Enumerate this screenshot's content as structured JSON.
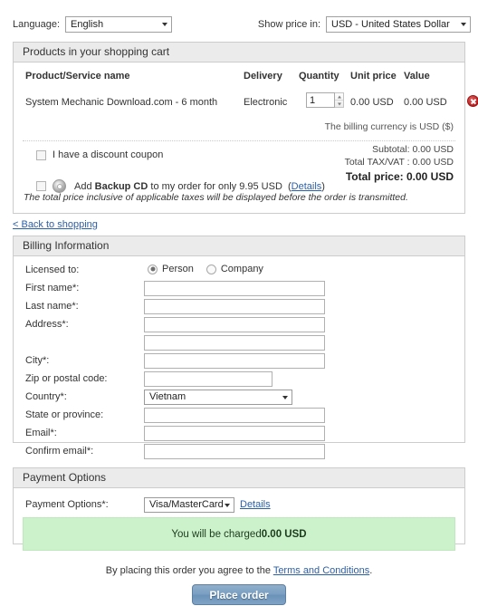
{
  "topbar": {
    "language_label": "Language:",
    "language_value": "English",
    "currency_label": "Show price in:",
    "currency_value": "USD - United States Dollar"
  },
  "cart": {
    "title": "Products in your shopping cart",
    "columns": {
      "name": "Product/Service name",
      "delivery": "Delivery",
      "quantity": "Quantity",
      "unit_price": "Unit price",
      "value": "Value"
    },
    "item": {
      "name": "System Mechanic Download.com - 6 month",
      "delivery": "Electronic",
      "quantity": "1",
      "unit_price": "0.00 USD",
      "value": "0.00 USD"
    },
    "billing_currency_note": "The billing currency is USD ($)",
    "coupon_label": "I have a discount coupon",
    "backup_cd_prefix": "Add ",
    "backup_cd_bold": "Backup CD",
    "backup_cd_suffix": " to my order for only 9.95 USD",
    "backup_cd_details": "Details",
    "totals": {
      "subtotal": "Subtotal: 0.00 USD",
      "tax": "Total TAX/VAT : 0.00 USD",
      "total": "Total price: 0.00 USD"
    },
    "tax_note": "The total price inclusive of applicable taxes will be displayed before the order is transmitted.",
    "back_link": "< Back to shopping"
  },
  "billing": {
    "title": "Billing Information",
    "licensed_to_label": "Licensed to:",
    "licensed_person": "Person",
    "licensed_company": "Company",
    "fields": [
      {
        "label": "First name*:",
        "value": ""
      },
      {
        "label": "Last name*:",
        "value": ""
      },
      {
        "label": "Address*:",
        "value": ""
      },
      {
        "label": "",
        "value": ""
      },
      {
        "label": "City*:",
        "value": ""
      },
      {
        "label": "Zip or postal code:",
        "value": ""
      },
      {
        "label": "Country*:",
        "value": "Vietnam"
      },
      {
        "label": "State or province:",
        "value": ""
      },
      {
        "label": "Email*:",
        "value": ""
      },
      {
        "label": "Confirm email*:",
        "value": ""
      }
    ]
  },
  "payment": {
    "title": "Payment Options",
    "option_label": "Payment Options*:",
    "option_value": "Visa/MasterCard",
    "details_link": "Details",
    "charge_prefix": "You will be charged ",
    "charge_amount": "0.00 USD"
  },
  "footer": {
    "terms_prefix": "By placing this order you agree to the ",
    "terms_link": "Terms and Conditions",
    "terms_suffix": ".",
    "place_order": "Place order"
  },
  "colors": {
    "panel_header": "#ebebeb",
    "banner_green": "#ccf2cb",
    "link_blue": "#2b5fa8",
    "delete_red": "#b81b1b",
    "button_blue": "#7ba0c2"
  }
}
